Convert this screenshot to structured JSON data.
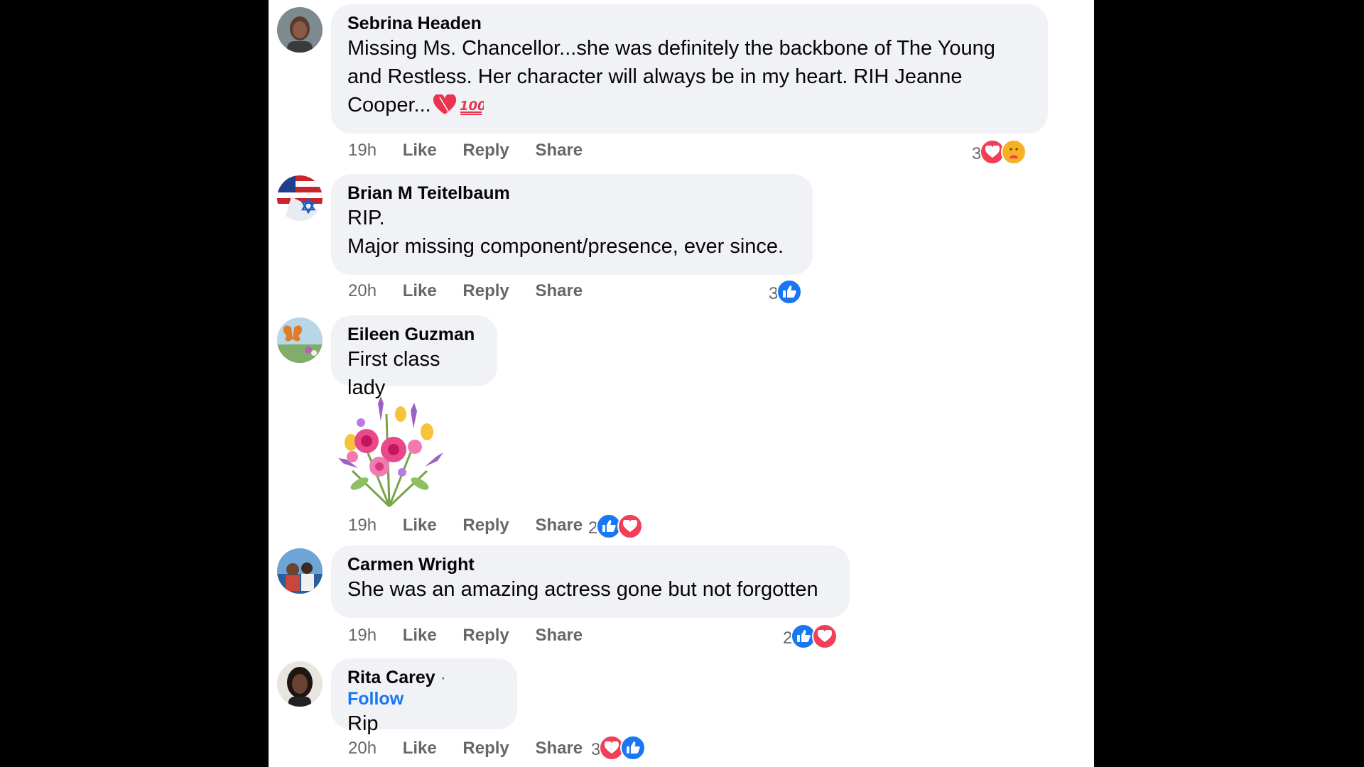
{
  "comments": [
    {
      "author": "Sebrina Headen",
      "lines": [
        "Missing Ms. Chancellor...she was definitely the backbone of The Young",
        "and Restless. Her character will always be in my heart. RIH Jeanne",
        "Cooper..."
      ],
      "time": "19h",
      "like": "Like",
      "reply": "Reply",
      "share": "Share",
      "reaction_count": "3",
      "reactions": [
        "love-icon",
        "care-icon"
      ]
    },
    {
      "author": "Brian M Teitelbaum",
      "lines": [
        "RIP.",
        "Major missing component/presence, ever since."
      ],
      "time": "20h",
      "like": "Like",
      "reply": "Reply",
      "share": "Share",
      "reaction_count": "3",
      "reactions": [
        "like-icon"
      ]
    },
    {
      "author": "Eileen Guzman",
      "lines": [
        "First class lady"
      ],
      "has_sticker": true,
      "time": "19h",
      "like": "Like",
      "reply": "Reply",
      "share": "Share",
      "reaction_count": "2",
      "reactions": [
        "like-icon",
        "love-icon"
      ]
    },
    {
      "author": "Carmen Wright",
      "lines": [
        "She was an amazing actress gone but not forgotten"
      ],
      "time": "19h",
      "like": "Like",
      "reply": "Reply",
      "share": "Share",
      "reaction_count": "2",
      "reactions": [
        "like-icon",
        "love-icon"
      ]
    },
    {
      "author": "Rita Carey",
      "follow_sep": " · ",
      "follow": "Follow",
      "lines": [
        "Rip"
      ],
      "time": "20h",
      "like": "Like",
      "reply": "Reply",
      "share": "Share",
      "reaction_count": "3",
      "reactions": [
        "love-icon",
        "like-icon"
      ]
    }
  ],
  "colors": {
    "bubble_bg": "#f0f2f5",
    "link_blue": "#1877f2",
    "meta_gray": "#65676b",
    "love_red": "#f33e58"
  }
}
